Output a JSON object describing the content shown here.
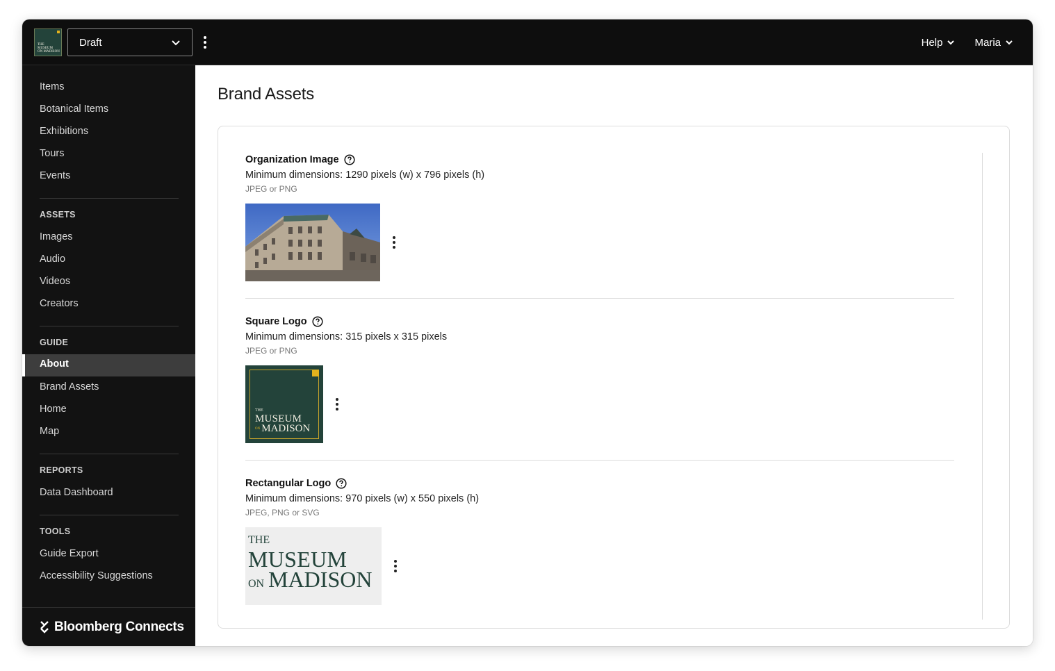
{
  "topbar": {
    "version_label": "Draft",
    "help_label": "Help",
    "user_label": "Maria",
    "logo_text": [
      "THE",
      "MUSEUM",
      "ON MADISON"
    ]
  },
  "sidebar": {
    "items": [
      "Items",
      "Botanical Items",
      "Exhibitions",
      "Tours",
      "Events"
    ],
    "assets_heading": "ASSETS",
    "assets": [
      "Images",
      "Audio",
      "Videos",
      "Creators"
    ],
    "guide_heading": "GUIDE",
    "guide": [
      "About",
      "Brand Assets",
      "Home",
      "Map"
    ],
    "reports_heading": "REPORTS",
    "reports": [
      "Data Dashboard"
    ],
    "tools_heading": "TOOLS",
    "tools": [
      "Guide Export",
      "Accessibility Suggestions"
    ],
    "active_item": "About",
    "footer_brand": "Bloomberg Connects"
  },
  "main": {
    "title": "Brand Assets",
    "sections": [
      {
        "title": "Organization Image",
        "dimensions": "Minimum dimensions: 1290 pixels (w) x 796 pixels (h)",
        "formats": "JPEG or PNG"
      },
      {
        "title": "Square Logo",
        "dimensions": "Minimum dimensions: 315 pixels x 315 pixels",
        "formats": "JPEG or PNG"
      },
      {
        "title": "Rectangular Logo",
        "dimensions": "Minimum dimensions: 970 pixels (w) x 550 pixels (h)",
        "formats": "JPEG, PNG or SVG"
      }
    ],
    "logo_text": {
      "the": "THE",
      "museum": "MUSEUM",
      "on": "ON",
      "madison": "MADISON"
    }
  },
  "colors": {
    "topbar_bg": "#0e0e0e",
    "sidebar_bg": "#121212",
    "active_bg": "#3d3d3d",
    "brand_green": "#23433a",
    "brand_gold": "#e3b21d"
  },
  "icons": {
    "chevron": "chevron-down-icon",
    "kebab": "more-vertical-icon",
    "help": "question-circle-icon",
    "brand": "bloomberg-connects-logo-icon"
  }
}
